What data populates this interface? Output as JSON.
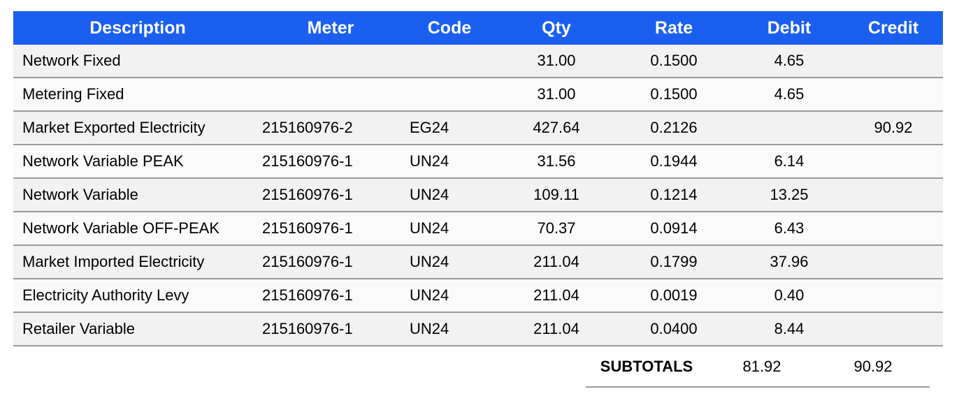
{
  "table": {
    "headers": [
      "Description",
      "Meter",
      "Code",
      "Qty",
      "Rate",
      "Debit",
      "Credit"
    ],
    "rows": [
      {
        "description": "Network Fixed",
        "meter": "",
        "code": "",
        "qty": "31.00",
        "rate": "0.1500",
        "debit": "4.65",
        "credit": ""
      },
      {
        "description": "Metering Fixed",
        "meter": "",
        "code": "",
        "qty": "31.00",
        "rate": "0.1500",
        "debit": "4.65",
        "credit": ""
      },
      {
        "description": "Market Exported Electricity",
        "meter": "215160976-2",
        "code": "EG24",
        "qty": "427.64",
        "rate": "0.2126",
        "debit": "",
        "credit": "90.92"
      },
      {
        "description": "Network Variable PEAK",
        "meter": "215160976-1",
        "code": "UN24",
        "qty": "31.56",
        "rate": "0.1944",
        "debit": "6.14",
        "credit": ""
      },
      {
        "description": "Network Variable",
        "meter": "215160976-1",
        "code": "UN24",
        "qty": "109.11",
        "rate": "0.1214",
        "debit": "13.25",
        "credit": ""
      },
      {
        "description": "Network Variable OFF-PEAK",
        "meter": "215160976-1",
        "code": "UN24",
        "qty": "70.37",
        "rate": "0.0914",
        "debit": "6.43",
        "credit": ""
      },
      {
        "description": "Market Imported Electricity",
        "meter": "215160976-1",
        "code": "UN24",
        "qty": "211.04",
        "rate": "0.1799",
        "debit": "37.96",
        "credit": ""
      },
      {
        "description": "Electricity Authority Levy",
        "meter": "215160976-1",
        "code": "UN24",
        "qty": "211.04",
        "rate": "0.0019",
        "debit": "0.40",
        "credit": ""
      },
      {
        "description": "Retailer Variable",
        "meter": "215160976-1",
        "code": "UN24",
        "qty": "211.04",
        "rate": "0.0400",
        "debit": "8.44",
        "credit": ""
      }
    ]
  },
  "subtotals": {
    "label": "SUBTOTALS",
    "debit": "81.92",
    "credit": "90.92"
  },
  "colors": {
    "header_bg": "#1b5ff0",
    "header_text": "#ffffff",
    "row_alt_a": "#f2f2f2",
    "row_alt_b": "#fafafa",
    "rule": "#9a9a9a"
  }
}
